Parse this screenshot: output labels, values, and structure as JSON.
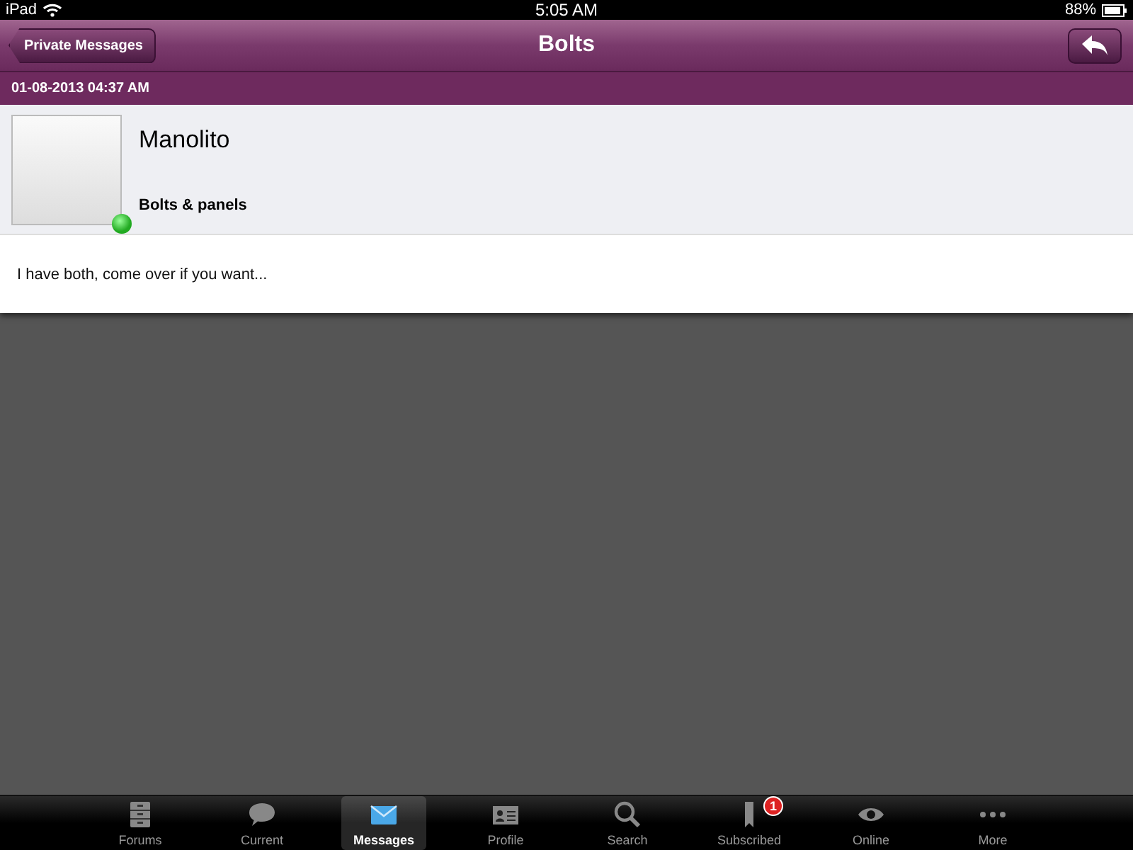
{
  "status_bar": {
    "device": "iPad",
    "time": "5:05 AM",
    "battery": "88%"
  },
  "nav_bar": {
    "back_button": "Private Messages",
    "title": "Bolts"
  },
  "message": {
    "date": "01-08-2013 04:37 AM",
    "sender": "Manolito",
    "online": true,
    "subject": "Bolts & panels",
    "body": "I have both, come over if you want..."
  },
  "tab_bar": [
    {
      "kind": "forums",
      "label": "Forums",
      "selected": false
    },
    {
      "kind": "current",
      "label": "Current",
      "selected": false
    },
    {
      "kind": "messages",
      "label": "Messages",
      "selected": true
    },
    {
      "kind": "profile",
      "label": "Profile",
      "selected": false
    },
    {
      "kind": "search",
      "label": "Search",
      "selected": false
    },
    {
      "kind": "subscribed",
      "label": "Subscribed",
      "selected": false,
      "badge": "1"
    },
    {
      "kind": "online",
      "label": "Online",
      "selected": false
    },
    {
      "kind": "more",
      "label": "More",
      "selected": false
    }
  ]
}
